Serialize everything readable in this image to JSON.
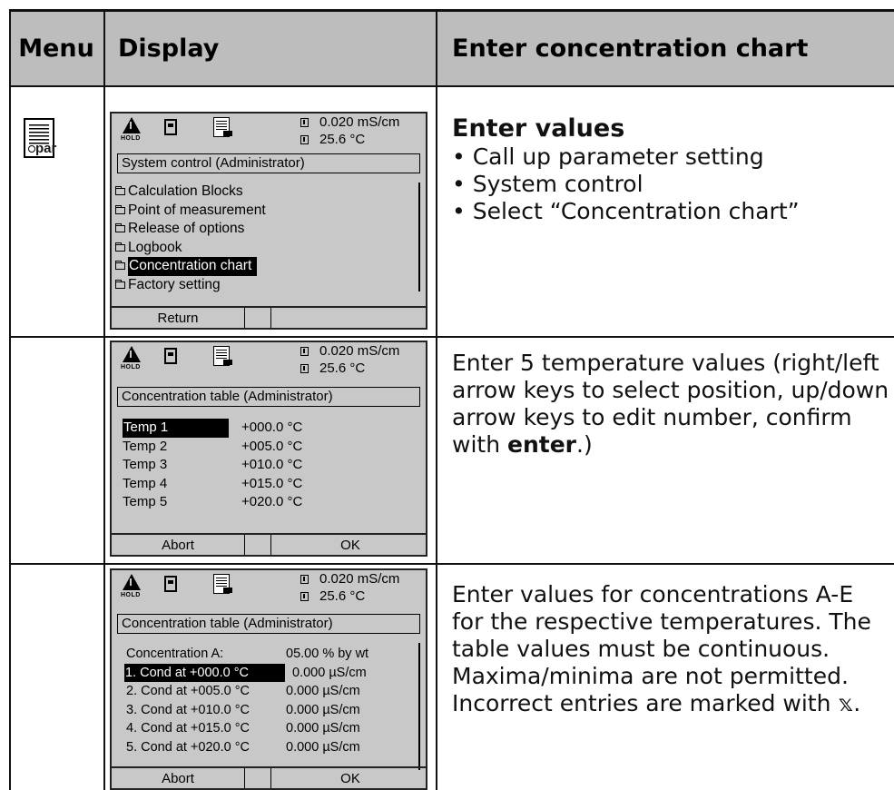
{
  "header": {
    "menu": "Menu",
    "display": "Display",
    "enter": "Enter concentration chart"
  },
  "menu_icon": {
    "label": "par"
  },
  "screen_status": {
    "hold": "HOLD",
    "conductivity": "0.020 mS/cm",
    "temperature": "25.6 °C"
  },
  "screen1": {
    "title": "System control (Administrator)",
    "items": [
      "Calculation Blocks",
      "Point of measurement",
      "Release of options",
      "Logbook",
      "Concentration chart",
      "Factory setting"
    ],
    "softkey_left": "Return",
    "softkey_right": ""
  },
  "screen2": {
    "title": "Concentration table (Administrator)",
    "rows": [
      {
        "label": "Temp 1",
        "value": "+000.0 °C"
      },
      {
        "label": "Temp 2",
        "value": "+005.0 °C"
      },
      {
        "label": "Temp 3",
        "value": "+010.0 °C"
      },
      {
        "label": "Temp 4",
        "value": "+015.0 °C"
      },
      {
        "label": "Temp 5",
        "value": "+020.0 °C"
      }
    ],
    "softkey_left": "Abort",
    "softkey_right": "OK"
  },
  "screen3": {
    "title": "Concentration table (Administrator)",
    "conc_label": "Concentration A:",
    "conc_value": "05.00 % by wt",
    "rows": [
      {
        "label": "1. Cond at  +000.0 °C",
        "value": "0.000 µS/cm"
      },
      {
        "label": "2. Cond at  +005.0 °C",
        "value": "0.000 µS/cm"
      },
      {
        "label": "3. Cond at  +010.0 °C",
        "value": "0.000 µS/cm"
      },
      {
        "label": "4. Cond at  +015.0 °C",
        "value": "0.000 µS/cm"
      },
      {
        "label": "5. Cond at  +020.0 °C",
        "value": "0.000 µS/cm"
      }
    ],
    "softkey_left": "Abort",
    "softkey_right": "OK"
  },
  "desc1": {
    "heading": "Enter values",
    "bullets": [
      "Call up parameter setting",
      "System control",
      "Select “Concentration chart”"
    ]
  },
  "desc2": {
    "text_before": "Enter 5 temperature values (right/left arrow keys to select position, up/down arrow keys to edit number, confirm with ",
    "bold": "enter",
    "text_after": ".)"
  },
  "desc3": {
    "text": "Enter values for concentrations A-E for the respective temperatures. The table values must be continuous. Maxima/minima are not permitted. Incorrect entries are marked with 𝕩."
  }
}
